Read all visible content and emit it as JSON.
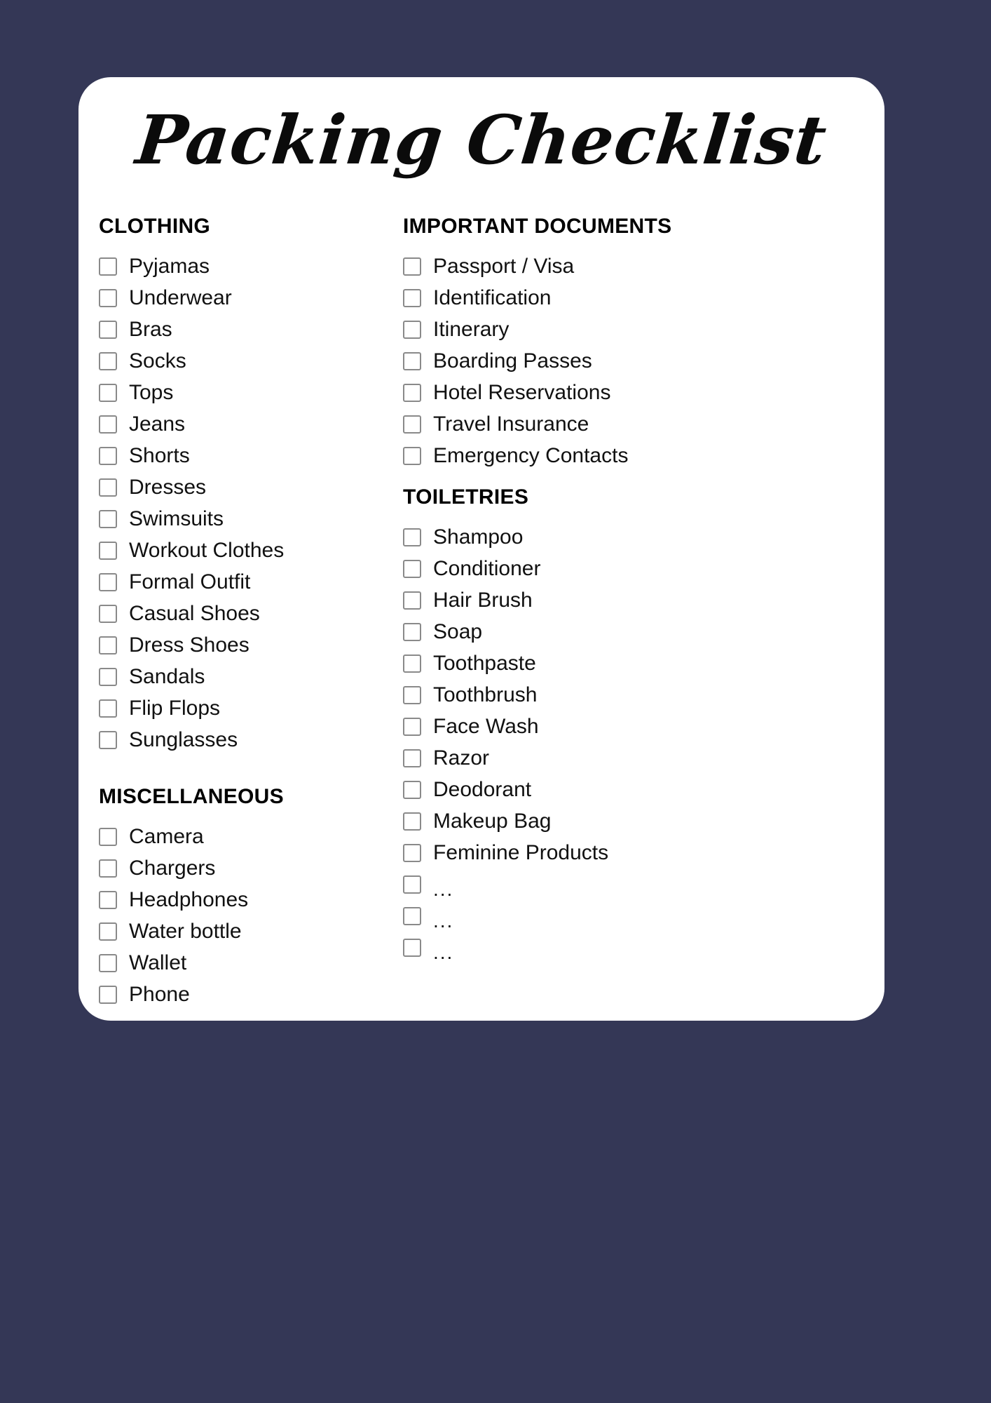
{
  "page": {
    "background_color": "#343756",
    "card_color": "#ffffff"
  },
  "header": {
    "title": "Packing Checklist"
  },
  "columns": {
    "left": [
      {
        "id": "clothing",
        "title": "CLOTHING",
        "items": [
          "Pyjamas",
          "Underwear",
          "Bras",
          "Socks",
          "Tops",
          "Jeans",
          "Shorts",
          "Dresses",
          "Swimsuits",
          "Workout Clothes",
          "Formal Outfit",
          "Casual Shoes",
          "Dress Shoes",
          "Sandals",
          "Flip Flops",
          "Sunglasses"
        ]
      },
      {
        "id": "miscellaneous",
        "title": "MISCELLANEOUS",
        "items": [
          "Camera",
          "Chargers",
          "Headphones",
          "Water bottle",
          "Wallet",
          "Phone"
        ]
      }
    ],
    "right": [
      {
        "id": "important-documents",
        "title": "IMPORTANT DOCUMENTS",
        "items": [
          "Passport / Visa",
          "Identification",
          "Itinerary",
          "Boarding Passes",
          "Hotel Reservations",
          "Travel Insurance",
          "Emergency Contacts"
        ]
      },
      {
        "id": "toiletries",
        "title": "TOILETRIES",
        "items": [
          "Shampoo",
          "Conditioner",
          "Hair Brush",
          "Soap",
          "Toothpaste",
          "Toothbrush",
          "Face Wash",
          "Razor",
          "Deodorant",
          "Makeup Bag",
          "Feminine Products",
          "...",
          "...",
          "..."
        ]
      }
    ]
  }
}
